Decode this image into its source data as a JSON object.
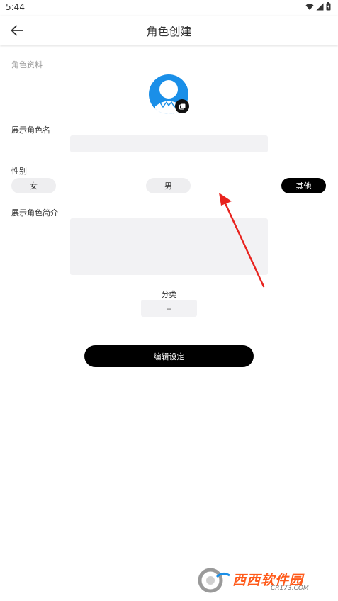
{
  "status_bar": {
    "time": "5:44"
  },
  "app_bar": {
    "title": "角色创建"
  },
  "section": {
    "profile_label": "角色资料"
  },
  "form": {
    "name_label": "展示角色名",
    "name_value": "",
    "gender_label": "性别",
    "gender_options": [
      "女",
      "男",
      "其他"
    ],
    "gender_selected": "其他",
    "intro_label": "展示角色简介",
    "intro_value": "",
    "category_label": "分类",
    "category_value": "--"
  },
  "actions": {
    "edit_settings_label": "编辑设定"
  },
  "colors": {
    "accent": "#1a8fe8",
    "primary_button": "#000000",
    "input_bg": "#f2f2f4",
    "annotation_arrow": "#e8231e"
  },
  "watermark": {
    "brand": "西西软件园",
    "domain": "CR173.COM"
  }
}
